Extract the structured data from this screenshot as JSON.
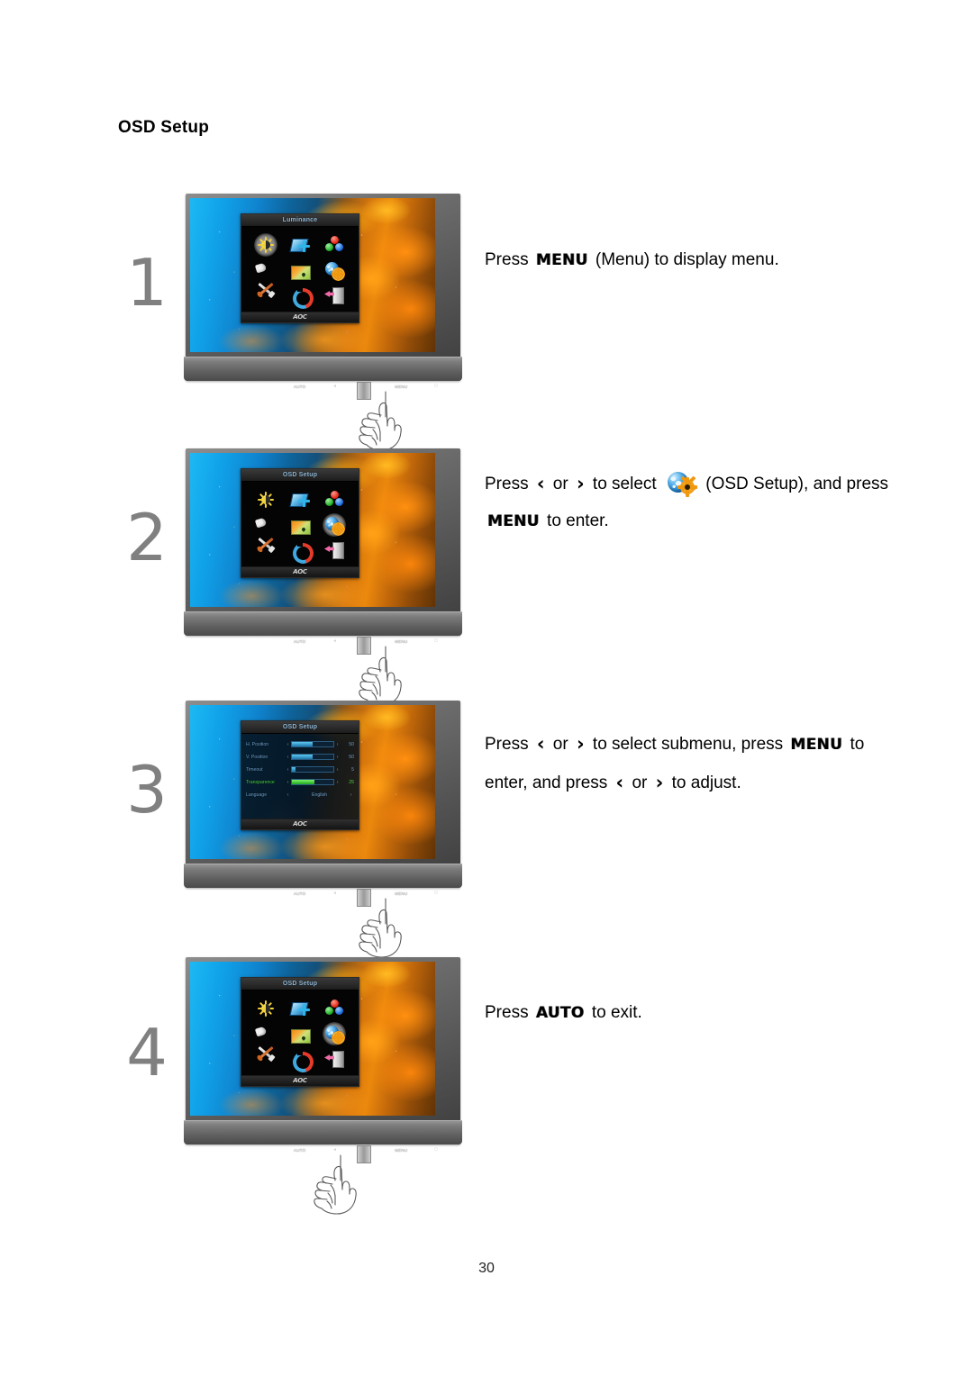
{
  "document": {
    "section_title": "OSD Setup",
    "page_number": "30"
  },
  "keys": {
    "menu": "MENU",
    "auto": "AUTO",
    "left": "‹",
    "right": "›"
  },
  "steps": [
    {
      "number": "1",
      "text_parts": {
        "p1": "Press",
        "key1": "MENU",
        "p2": "(Menu) to display menu."
      },
      "osd": {
        "title": "Luminance",
        "logo": "AOC",
        "selected_icon": "luminance",
        "icons": [
          "luminance-icon",
          "image-setup-icon",
          "color-setup-icon",
          "picture-boost-icon",
          "osd-picture-icon",
          "osd-setup-icon",
          "extra-tools-icon",
          "reset-icon",
          "exit-door-icon"
        ]
      },
      "buttons": [
        "AUTO",
        "◄",
        "►",
        "MENU",
        "⏻"
      ]
    },
    {
      "number": "2",
      "text_parts": {
        "p1": "Press",
        "left": "‹",
        "or": "or",
        "right": "›",
        "p2": "to select",
        "icon": "osd-setup-icon",
        "p3": "(OSD Setup), and press",
        "key1": "MENU",
        "p4": "to enter."
      },
      "osd": {
        "title": "OSD Setup",
        "logo": "AOC",
        "selected_icon": "osd-setup",
        "icons": [
          "luminance-icon",
          "image-setup-icon",
          "color-setup-icon",
          "picture-boost-icon",
          "osd-picture-icon",
          "osd-setup-icon",
          "extra-tools-icon",
          "reset-icon",
          "exit-door-icon"
        ]
      },
      "buttons": [
        "AUTO",
        "◄",
        "►",
        "MENU",
        "⏻"
      ]
    },
    {
      "number": "3",
      "text_parts": {
        "p1": "Press",
        "left": "‹",
        "or": "or",
        "right": "›",
        "p2": "to select submenu, press",
        "key1": "MENU",
        "p3": "to enter, and press",
        "left2": "‹",
        "or2": "or",
        "right2": "›",
        "p4": "to",
        "p5": "adjust."
      },
      "osd": {
        "title": "OSD Setup",
        "logo": "AOC",
        "rows": [
          {
            "label": "H. Position",
            "value": "50",
            "fill_pct": 50,
            "active": false,
            "type": "slider"
          },
          {
            "label": "V. Position",
            "value": "50",
            "fill_pct": 50,
            "active": false,
            "type": "slider"
          },
          {
            "label": "Timeout",
            "value": "5",
            "fill_pct": 8,
            "active": false,
            "type": "slider"
          },
          {
            "label": "Transparence",
            "value": "25",
            "fill_pct": 55,
            "active": true,
            "type": "slider"
          },
          {
            "label": "Language",
            "value": "English",
            "fill_pct": 0,
            "active": false,
            "type": "option"
          }
        ]
      },
      "buttons": [
        "AUTO",
        "◄",
        "►",
        "MENU",
        "⏻"
      ]
    },
    {
      "number": "4",
      "text_parts": {
        "p1": "Press",
        "key1": "AUTO",
        "p2": "to exit."
      },
      "osd": {
        "title": "OSD Setup",
        "logo": "AOC",
        "selected_icon": "osd-setup",
        "icons": [
          "luminance-icon",
          "image-setup-icon",
          "color-setup-icon",
          "picture-boost-icon",
          "osd-picture-icon",
          "osd-setup-icon",
          "extra-tools-icon",
          "reset-icon",
          "exit-door-icon"
        ]
      },
      "buttons": [
        "AUTO",
        "◄",
        "►",
        "MENU",
        "⏻"
      ]
    }
  ],
  "colors": {
    "osd_title_text": "#8fb8d8",
    "osd_active_green": "#49d23a",
    "osd_label_blue": "#6f9ec6",
    "step_number_gray": "#6b6b6b"
  }
}
